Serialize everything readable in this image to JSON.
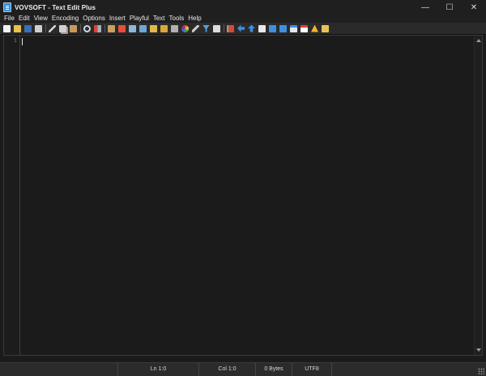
{
  "window": {
    "title": "VOVSOFT - Text Edit Plus",
    "controls": {
      "minimize": "—",
      "maximize": "☐",
      "close": "✕"
    }
  },
  "menu": [
    "File",
    "Edit",
    "View",
    "Encoding",
    "Options",
    "Insert",
    "Playful",
    "Text",
    "Tools",
    "Help"
  ],
  "toolbar": {
    "groups": [
      [
        "new-file-icon",
        "open-folder-icon",
        "save-icon",
        "print-icon"
      ],
      [
        "cut-icon",
        "copy-icon",
        "paste-icon"
      ],
      [
        "find-icon",
        "replace-icon"
      ],
      [
        "export-icon",
        "pdf-icon",
        "monitor-icon",
        "image-icon",
        "lock-icon",
        "unlock-icon",
        "hash-icon",
        "color-wheel-icon",
        "pen-icon",
        "filter-icon",
        "mail-icon"
      ],
      [
        "flag-icon",
        "arrow-left-icon",
        "arrow-up-icon",
        "document-icon",
        "sort-az-icon",
        "sort-za-icon",
        "calendar-icon",
        "calendar-day-icon",
        "warning-icon",
        "edit-doc-icon"
      ]
    ]
  },
  "editor": {
    "line_number": "1"
  },
  "status": {
    "line": "Ln 1:0",
    "column": "Col 1:0",
    "size": "0 Bytes",
    "encoding": "UTF8"
  }
}
